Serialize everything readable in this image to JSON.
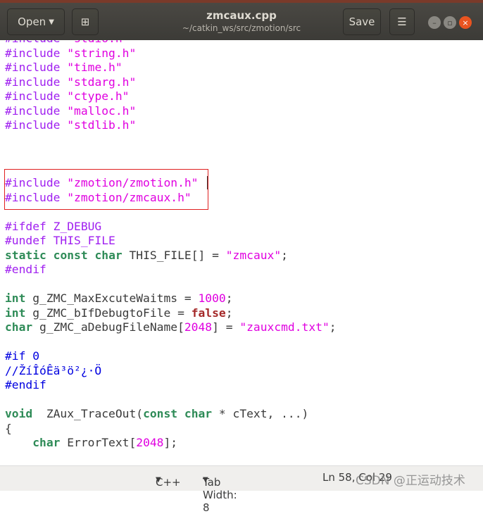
{
  "header": {
    "open_label": "Open",
    "title": "zmcaux.cpp",
    "subtitle": "~/catkin_ws/src/zmotion/src",
    "save_label": "Save",
    "new_tab_icon": "new-document-icon",
    "menu_icon": "hamburger-icon",
    "close_symbol": "×"
  },
  "code_lines": [
    [
      [
        "pp",
        "#include "
      ],
      [
        "str",
        "\"stdio.h\""
      ]
    ],
    [
      [
        "pp",
        "#include "
      ],
      [
        "str",
        "\"string.h\""
      ]
    ],
    [
      [
        "pp",
        "#include "
      ],
      [
        "str",
        "\"time.h\""
      ]
    ],
    [
      [
        "pp",
        "#include "
      ],
      [
        "str",
        "\"stdarg.h\""
      ]
    ],
    [
      [
        "pp",
        "#include "
      ],
      [
        "str",
        "\"ctype.h\""
      ]
    ],
    [
      [
        "pp",
        "#include "
      ],
      [
        "str",
        "\"malloc.h\""
      ]
    ],
    [
      [
        "pp",
        "#include "
      ],
      [
        "str",
        "\"stdlib.h\""
      ]
    ],
    [],
    [],
    [],
    [
      [
        "pp",
        "#include "
      ],
      [
        "str",
        "\"zmotion/zmotion.h\""
      ]
    ],
    [
      [
        "pp",
        "#include "
      ],
      [
        "str",
        "\"zmotion/zmcaux.h\""
      ]
    ],
    [],
    [
      [
        "pp",
        "#ifdef Z_DEBUG"
      ]
    ],
    [
      [
        "pp",
        "#undef THIS_FILE"
      ]
    ],
    [
      [
        "type",
        "static"
      ],
      [
        "plain",
        " "
      ],
      [
        "type",
        "const"
      ],
      [
        "plain",
        " "
      ],
      [
        "type",
        "char"
      ],
      [
        "plain",
        " THIS_FILE[] = "
      ],
      [
        "str",
        "\"zmcaux\""
      ],
      [
        "plain",
        ";"
      ]
    ],
    [
      [
        "pp",
        "#endif"
      ]
    ],
    [],
    [
      [
        "type",
        "int"
      ],
      [
        "plain",
        " g_ZMC_MaxExcuteWaitms = "
      ],
      [
        "num",
        "1000"
      ],
      [
        "plain",
        ";"
      ]
    ],
    [
      [
        "type",
        "int"
      ],
      [
        "plain",
        " g_ZMC_bIfDebugtoFile = "
      ],
      [
        "bool",
        "false"
      ],
      [
        "plain",
        ";"
      ]
    ],
    [
      [
        "type",
        "char"
      ],
      [
        "plain",
        " g_ZMC_aDebugFileName["
      ],
      [
        "num",
        "2048"
      ],
      [
        "plain",
        "] = "
      ],
      [
        "str",
        "\"zauxcmd.txt\""
      ],
      [
        "plain",
        ";"
      ]
    ],
    [],
    [
      [
        "cmt",
        "#if 0"
      ]
    ],
    [
      [
        "cmt",
        "//ŽíÎóÊä³ö²¿·Ö"
      ]
    ],
    [
      [
        "cmt",
        "#endif"
      ]
    ],
    [],
    [
      [
        "type",
        "void"
      ],
      [
        "plain",
        "  ZAux_TraceOut("
      ],
      [
        "type",
        "const"
      ],
      [
        "plain",
        " "
      ],
      [
        "type",
        "char"
      ],
      [
        "plain",
        " * cText, ...)"
      ]
    ],
    [
      [
        "plain",
        "{"
      ]
    ],
    [
      [
        "plain",
        "    "
      ],
      [
        "type",
        "char"
      ],
      [
        "plain",
        " ErrorText["
      ],
      [
        "num",
        "2048"
      ],
      [
        "plain",
        "];"
      ]
    ]
  ],
  "status": {
    "language": "C++",
    "tab_width": "Tab Width: 8",
    "position": "Ln 58, Col 29"
  },
  "watermark": "CSDN @正运动技术",
  "colors": {
    "preprocessor": "#a020f0",
    "string": "#e000e0",
    "type": "#2e8b57",
    "bool": "#a52a2a",
    "comment": "#0000e0",
    "highlight_box": "#e02020"
  }
}
